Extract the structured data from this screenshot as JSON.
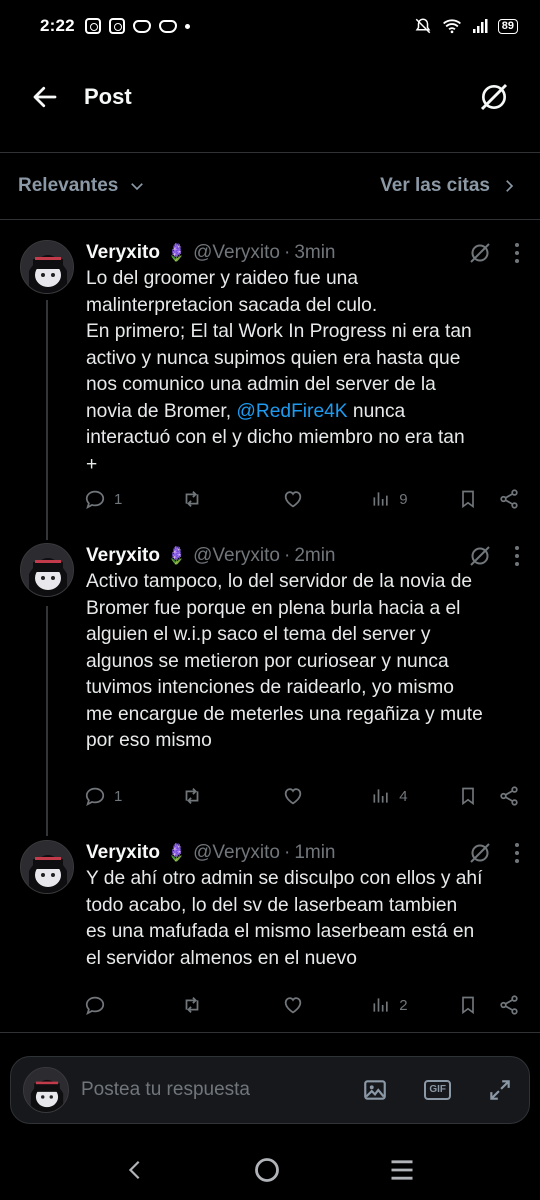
{
  "status_bar": {
    "time": "2:22",
    "battery": "89"
  },
  "header": {
    "title": "Post"
  },
  "filter": {
    "left_label": "Relevantes",
    "right_label": "Ver las citas"
  },
  "posts": [
    {
      "name": "Veryxito",
      "emoji": "🪻",
      "handle": "@Veryxito",
      "sep": "·",
      "time": "3min",
      "text_before": "Lo del groomer y raideo fue una\nmalinterpretacion sacada del culo.\nEn primero; El tal Work In Progress ni era tan\nactivo y nunca supimos quien era hasta que\nnos comunico una admin del server de la\nnovia de Bromer, ",
      "mention": "@RedFire4K",
      "text_after": " nunca\ninteractuó con el y dicho miembro no era tan\n+",
      "replies": "1",
      "retweets": "",
      "likes": "",
      "views": "9"
    },
    {
      "name": "Veryxito",
      "emoji": "🪻",
      "handle": "@Veryxito",
      "sep": "·",
      "time": "2min",
      "text": "Activo tampoco, lo del servidor de la novia de\nBromer fue porque en plena burla hacia a el\nalguien el w.i.p saco el tema del server y\nalgunos se metieron por curiosear y nunca\ntuvimos intenciones de raidearlo, yo mismo\nme encargue de meterles una regañiza y mute\npor eso mismo",
      "replies": "1",
      "retweets": "",
      "likes": "",
      "views": "4"
    },
    {
      "name": "Veryxito",
      "emoji": "🪻",
      "handle": "@Veryxito",
      "sep": "·",
      "time": "1min",
      "text": "Y de ahí otro admin se disculpo con ellos y ahí\ntodo acabo, lo del sv de laserbeam tambien\nes una mafufada el mismo laserbeam está en\nel servidor almenos en el nuevo",
      "replies": "",
      "retweets": "",
      "likes": "",
      "views": "2"
    }
  ],
  "reply_bar": {
    "placeholder": "Postea tu respuesta",
    "gif_label": "GIF"
  },
  "icons": {
    "back": "arrow-left-icon",
    "grok": "grok-icon",
    "chevron": "chevron-icon",
    "reply": "comment-icon",
    "retweet": "repost-icon",
    "like": "heart-icon",
    "views": "bar-chart-icon",
    "bookmark": "bookmark-icon",
    "share": "share-icon"
  },
  "colors": {
    "accent": "#1d9bf0",
    "muted": "#71767b",
    "background": "#000000"
  }
}
